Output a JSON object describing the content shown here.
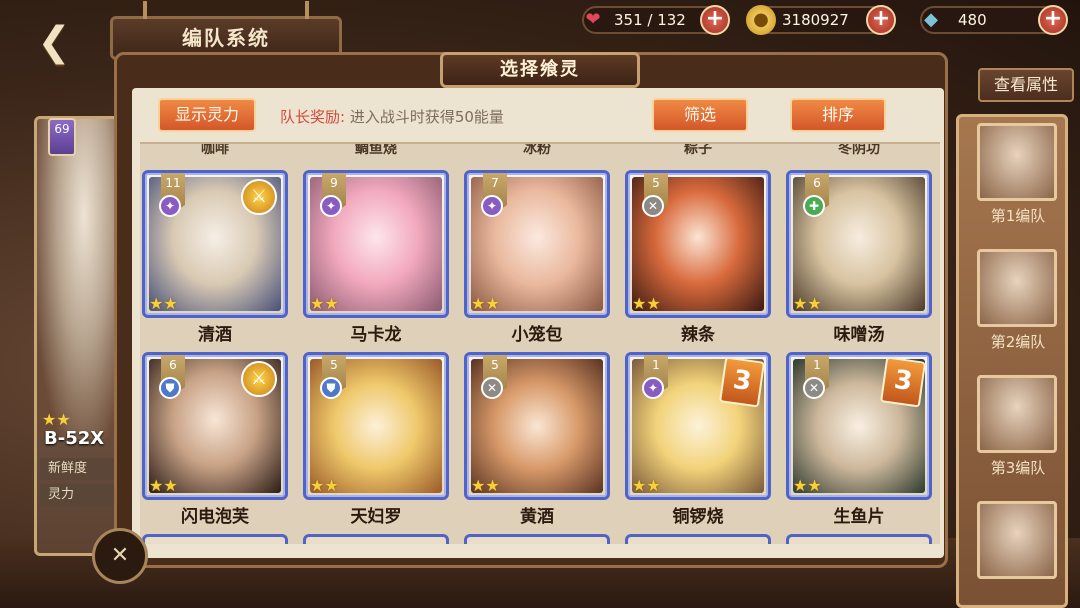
{
  "header": {
    "back_icon": "back-arrow-icon",
    "title": "编队系统",
    "view_attributes": "查看属性"
  },
  "resources": [
    {
      "name": "stamina",
      "icon": "heart-icon",
      "value": "351 / 132",
      "color": "#e2475a"
    },
    {
      "name": "coins",
      "icon": "coin-icon",
      "value": "3180927",
      "color": "#e5b63a"
    },
    {
      "name": "gems",
      "icon": "crystal-icon",
      "value": "480",
      "color": "#7ac3d8"
    }
  ],
  "character": {
    "level": "69",
    "name": "B-52X",
    "stats": [
      "新鲜度",
      "灵力"
    ]
  },
  "teams": [
    {
      "label": "第1编队"
    },
    {
      "label": "第2编队"
    },
    {
      "label": "第3编队"
    },
    {
      "label": ""
    }
  ],
  "modal": {
    "title": "选择飨灵",
    "show_spirit_button": "显示灵力",
    "captain_bonus_label": "队长奖励:",
    "captain_bonus_text": "进入战斗时获得50能量",
    "filter_button": "筛选",
    "sort_button": "排序"
  },
  "top_partial_names": [
    "咖啡",
    "鲷鱼烧",
    "冰粉",
    "粽子",
    "冬阴功"
  ],
  "cards": [
    {
      "name": "清酒",
      "level": "11",
      "type": "purple",
      "stars": 2,
      "equip": true,
      "badge": ""
    },
    {
      "name": "马卡龙",
      "level": "9",
      "type": "purple",
      "stars": 2,
      "equip": false,
      "badge": ""
    },
    {
      "name": "小笼包",
      "level": "7",
      "type": "purple",
      "stars": 2,
      "equip": false,
      "badge": ""
    },
    {
      "name": "辣条",
      "level": "5",
      "type": "gray",
      "stars": 2,
      "equip": false,
      "badge": ""
    },
    {
      "name": "味噌汤",
      "level": "6",
      "type": "green",
      "stars": 2,
      "equip": false,
      "badge": ""
    },
    {
      "name": "闪电泡芙",
      "level": "6",
      "type": "blue",
      "stars": 2,
      "equip": true,
      "badge": ""
    },
    {
      "name": "天妇罗",
      "level": "5",
      "type": "blue",
      "stars": 2,
      "equip": false,
      "badge": ""
    },
    {
      "name": "黄酒",
      "level": "5",
      "type": "gray",
      "stars": 2,
      "equip": false,
      "badge": ""
    },
    {
      "name": "铜锣烧",
      "level": "1",
      "type": "purple",
      "stars": 2,
      "equip": false,
      "badge": "3"
    },
    {
      "name": "生鱼片",
      "level": "1",
      "type": "gray",
      "stars": 2,
      "equip": false,
      "badge": "3"
    }
  ],
  "colors": {
    "accent_orange": "#e06e35",
    "card_border": "#5063c7",
    "type_purple": "#8a5cc2",
    "type_green": "#4bab55",
    "type_blue": "#4e78c9",
    "type_gray": "#8d8a86"
  }
}
